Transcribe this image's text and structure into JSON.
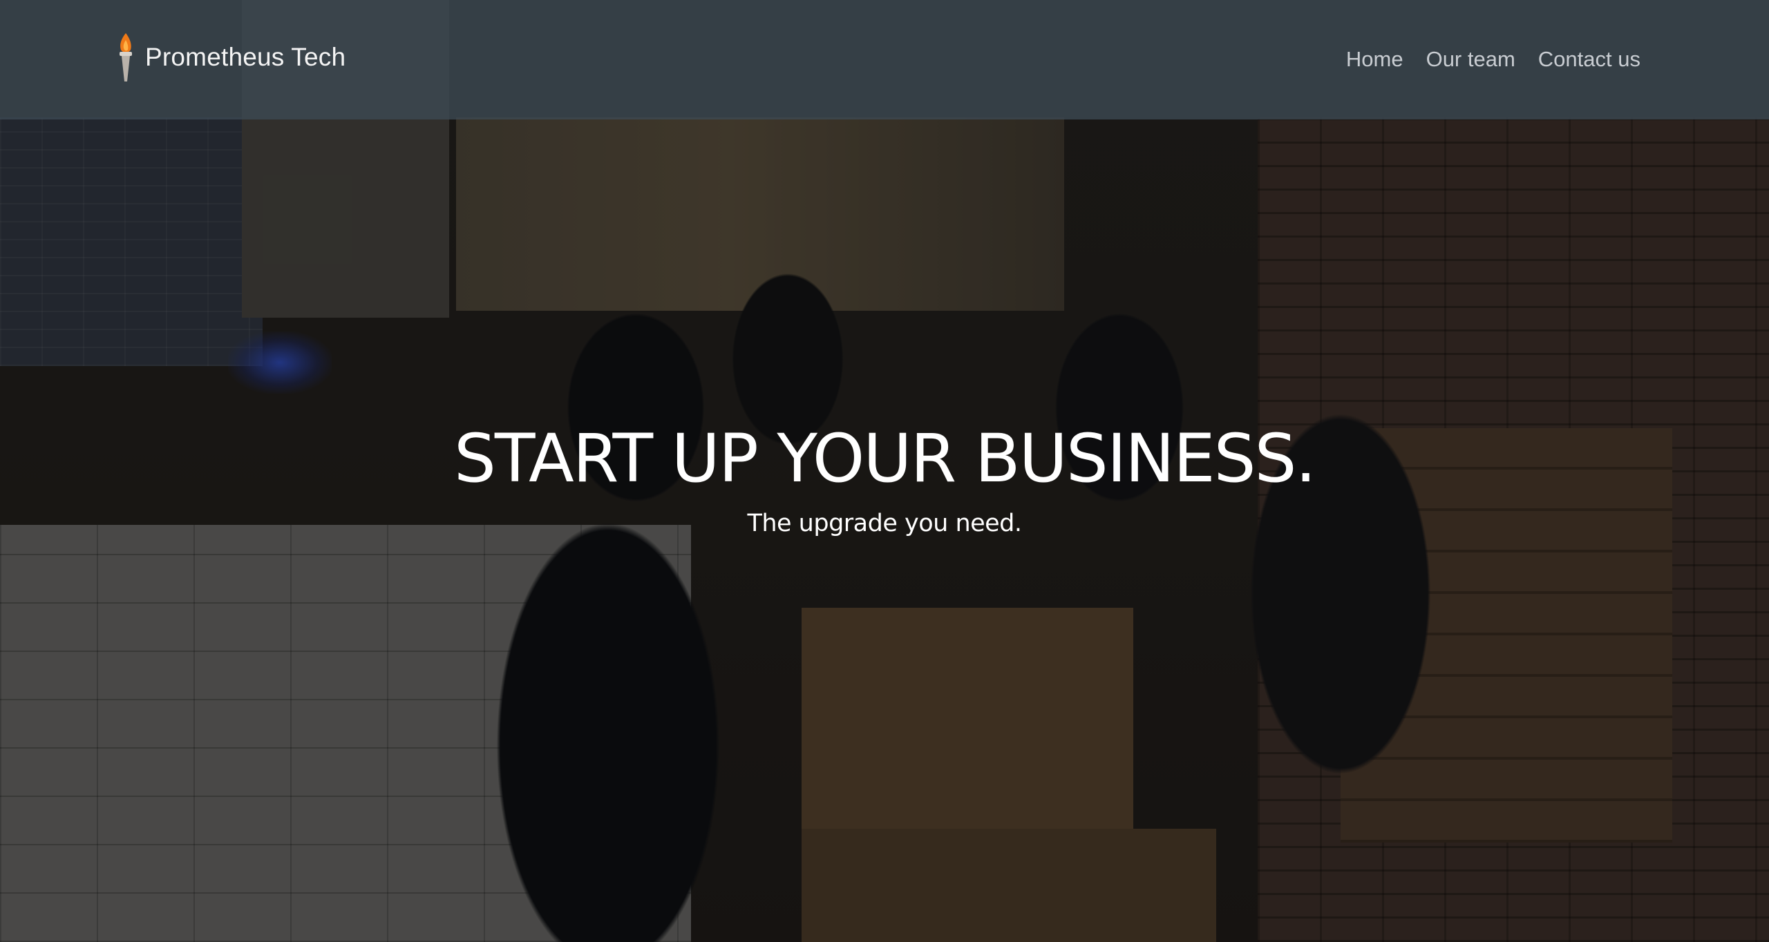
{
  "navbar": {
    "brand": {
      "name": "Prometheus Tech",
      "logo_icon": "torch-icon",
      "logo_colors": {
        "flame": "#f07a18",
        "handle": "#c9c3bc"
      }
    },
    "links": [
      {
        "label": "Home"
      },
      {
        "label": "Our team"
      },
      {
        "label": "Contact us"
      }
    ],
    "background": "#3e4a54"
  },
  "hero": {
    "title": "START UP YOUR BUSINESS.",
    "subtitle": "The upgrade you need.",
    "background_image": "team-photo-in-cafe"
  }
}
